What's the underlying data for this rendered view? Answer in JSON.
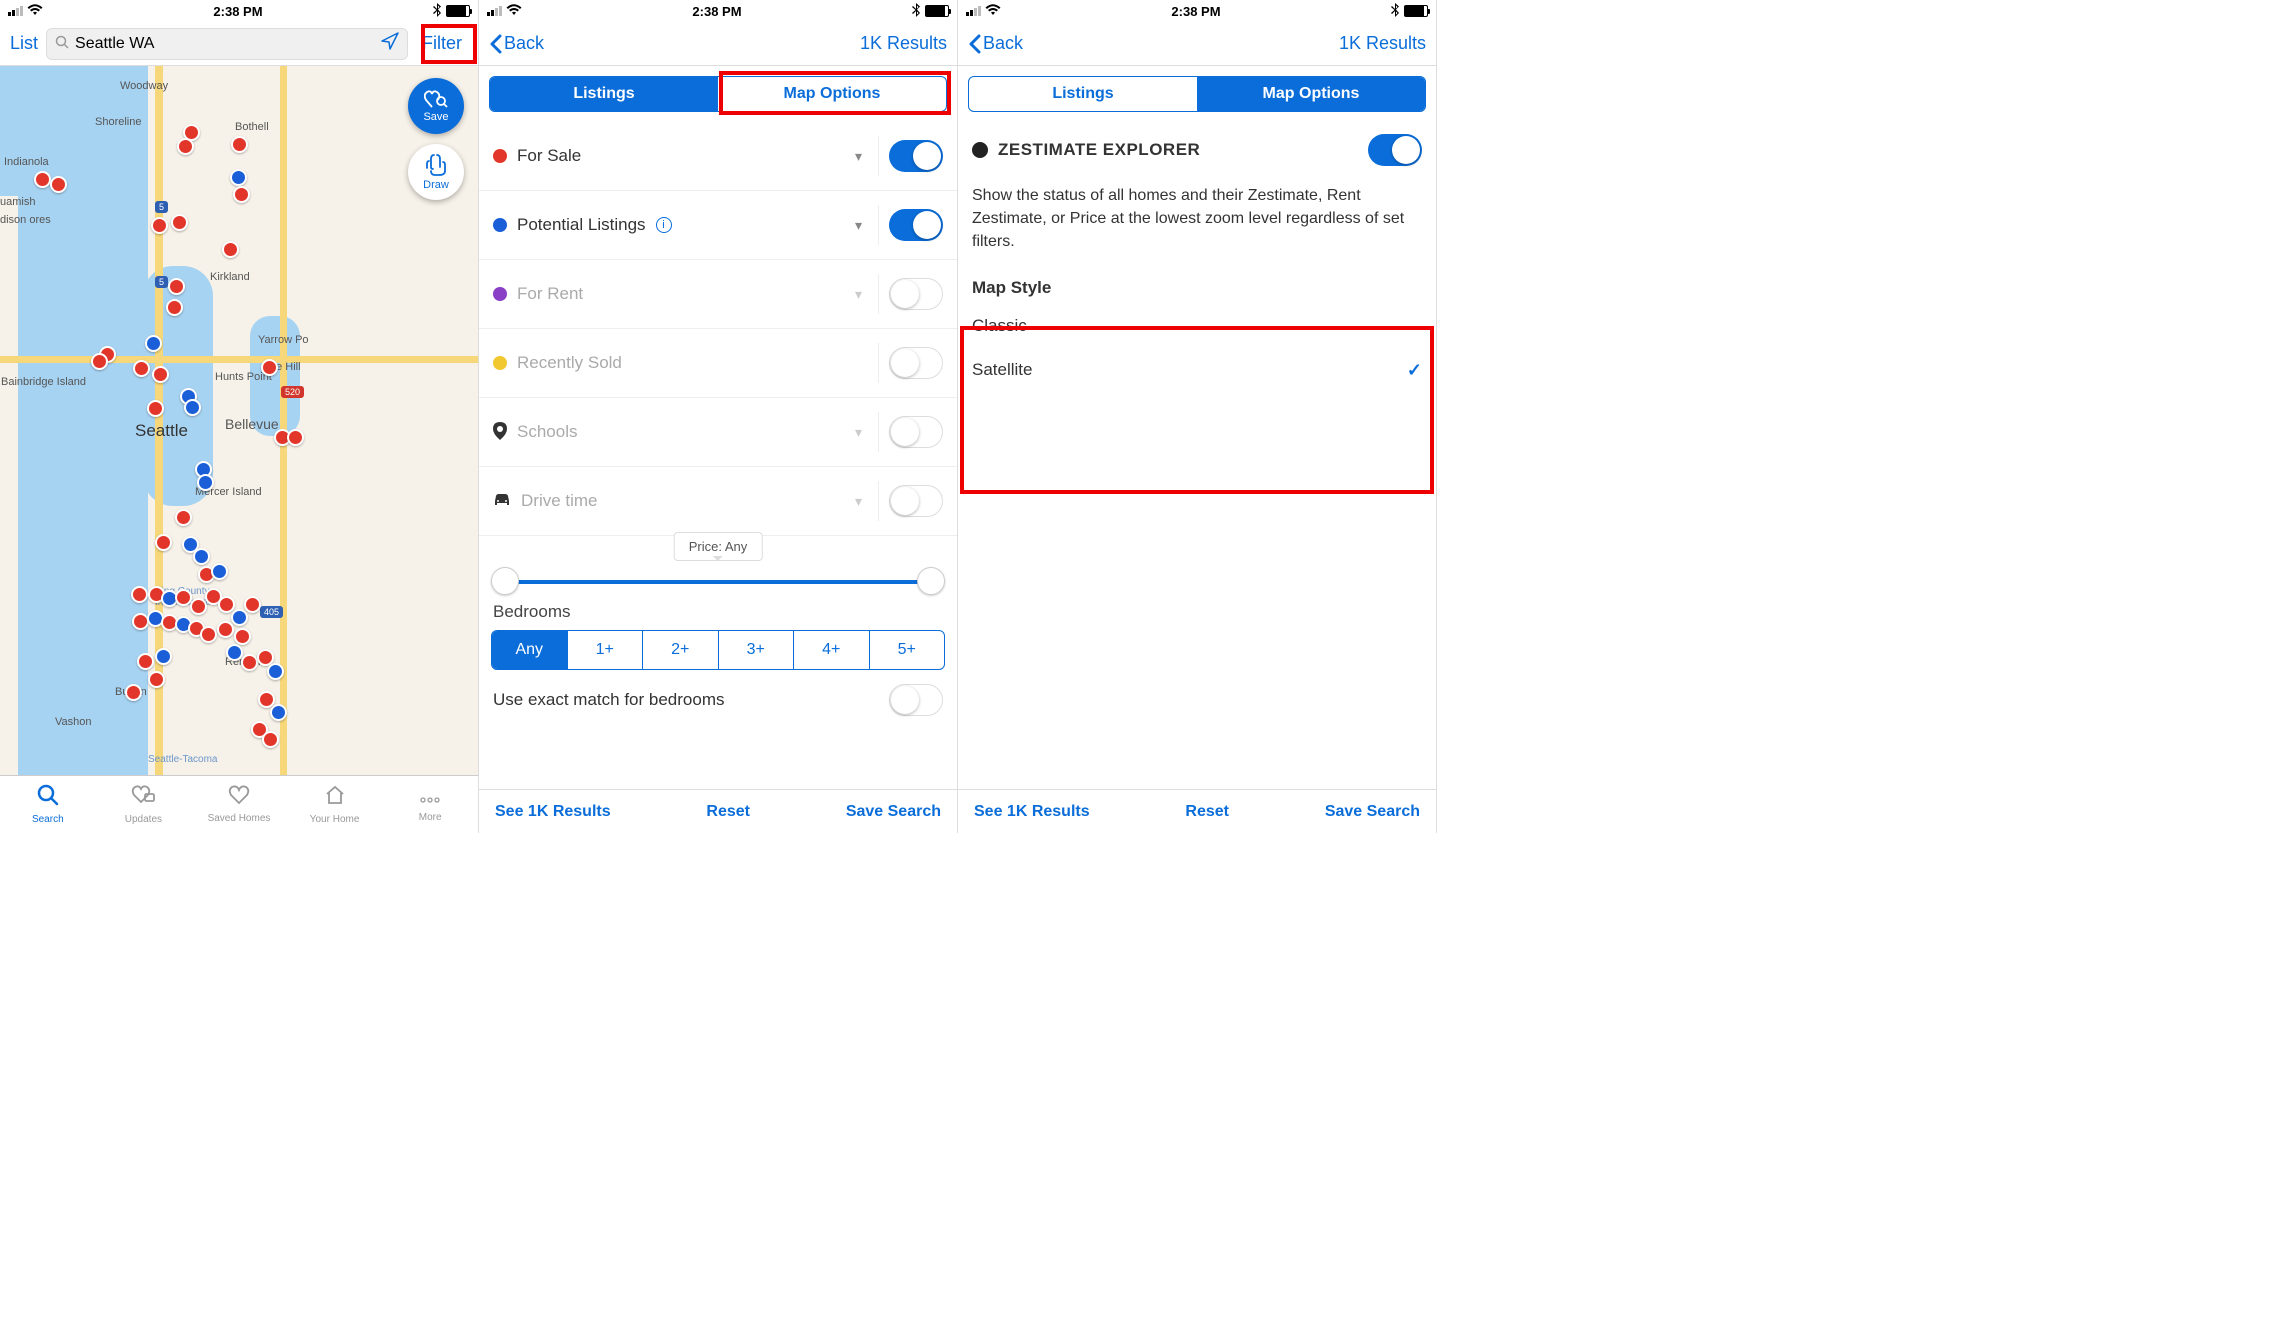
{
  "status": {
    "time": "2:38 PM"
  },
  "screen1": {
    "list_label": "List",
    "search_value": "Seattle WA",
    "filter_label": "Filter",
    "map_labels": [
      "Indianola",
      "uamish",
      "Bainbridge Island",
      "Woodway",
      "Shoreline",
      "Bothell",
      "Kirkland",
      "Yarrow Po",
      "de Hill",
      "Hunts Point",
      "Bellevue",
      "Mercer Island",
      "Renton",
      "Burien",
      "Vashon",
      "Seattle",
      "King County International",
      "Seattle-Tacoma",
      "dison ores"
    ],
    "fab_save": "Save",
    "fab_draw": "Draw",
    "tabs": {
      "search": "Search",
      "updates": "Updates",
      "saved": "Saved Homes",
      "home": "Your Home",
      "more": "More"
    }
  },
  "screen2": {
    "back": "Back",
    "results": "1K Results",
    "seg": {
      "listings": "Listings",
      "map_options": "Map Options"
    },
    "filters": {
      "for_sale": "For Sale",
      "potential": "Potential Listings",
      "for_rent": "For Rent",
      "recently_sold": "Recently Sold",
      "schools": "Schools",
      "drive_time": "Drive time"
    },
    "price_tip": "Price: Any",
    "bedrooms_label": "Bedrooms",
    "bed_options": [
      "Any",
      "1+",
      "2+",
      "3+",
      "4+",
      "5+"
    ],
    "exact_label": "Use exact match for bedrooms",
    "actions": {
      "see": "See 1K Results",
      "reset": "Reset",
      "save": "Save Search"
    }
  },
  "screen3": {
    "back": "Back",
    "results": "1K Results",
    "seg": {
      "listings": "Listings",
      "map_options": "Map Options"
    },
    "zest_title": "ZESTIMATE EXPLORER",
    "zest_desc": "Show the status of all homes and their Zestimate, Rent Zestimate, or Price at the lowest zoom level regardless of set filters.",
    "map_style_title": "Map Style",
    "styles": {
      "classic": "Classic",
      "satellite": "Satellite"
    },
    "actions": {
      "see": "See 1K Results",
      "reset": "Reset",
      "save": "Save Search"
    }
  }
}
